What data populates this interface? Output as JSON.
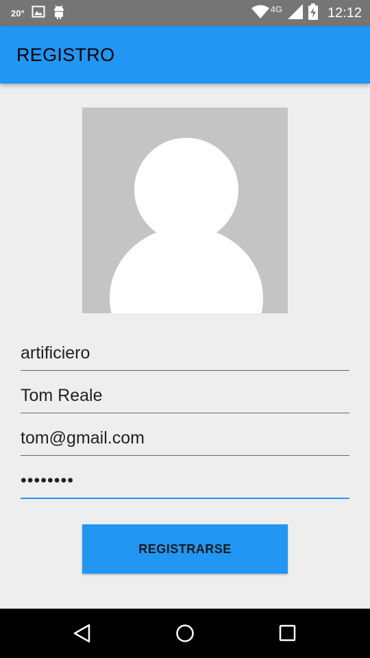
{
  "status_bar": {
    "temperature": "20°",
    "network_type": "4G",
    "time": "12:12",
    "icons": [
      "image-icon",
      "android-icon",
      "wifi-icon",
      "signal-icon",
      "battery-charging-icon"
    ]
  },
  "app_bar": {
    "title": "REGISTRO",
    "color": "#2196F3"
  },
  "avatar": {
    "icon": "person-placeholder-icon",
    "background": "#C4C4C4"
  },
  "form": {
    "username": "artificiero",
    "full_name": "Tom Reale",
    "email": "tom@gmail.com",
    "password": "••••••••"
  },
  "register_button": {
    "label": "REGISTRARSE"
  },
  "nav_bar": {
    "icons": [
      "back-icon",
      "home-icon",
      "recents-icon"
    ]
  }
}
